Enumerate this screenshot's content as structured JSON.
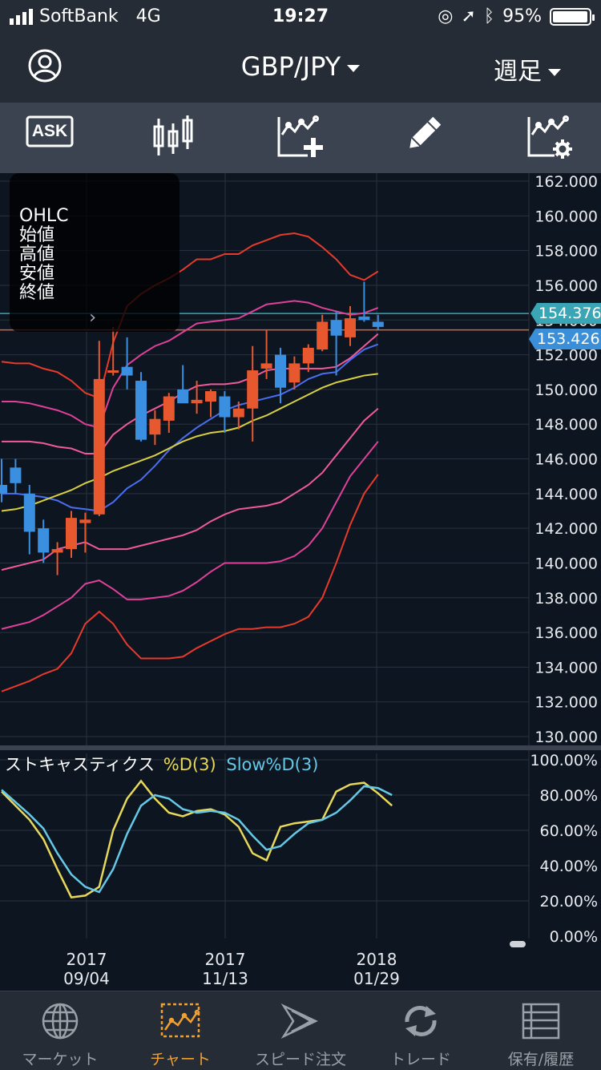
{
  "status_bar": {
    "carrier": "SoftBank",
    "network": "4G",
    "time": "19:27",
    "battery": "95%"
  },
  "header": {
    "pair": "GBP/JPY",
    "period": "週足"
  },
  "toolbar": {
    "ask_label": "ASK",
    "icons": [
      "ask-toggle-icon",
      "candlestick-icon",
      "add-indicator-icon",
      "draw-pencil-icon",
      "indicator-settings-icon"
    ]
  },
  "ohlc_panel": {
    "title": "OHLC",
    "open": "始値",
    "high": "高値",
    "low": "安値",
    "close": "終値"
  },
  "price_tags": {
    "bid": "154.376",
    "current": "153.426"
  },
  "chart_data": [
    {
      "type": "candlestick",
      "title": "GBP/JPY 週足",
      "y_ticks": [
        "162.000",
        "160.000",
        "158.000",
        "156.000",
        "154.000",
        "152.000",
        "150.000",
        "148.000",
        "146.000",
        "144.000",
        "142.000",
        "140.000",
        "138.000",
        "136.000",
        "134.000",
        "132.000",
        "130.000"
      ],
      "ylim": [
        130,
        162
      ],
      "x_ticks": [
        {
          "year": "2017",
          "date": "09/04"
        },
        {
          "year": "2017",
          "date": "11/13"
        },
        {
          "year": "2018",
          "date": "01/29"
        }
      ],
      "candles": [
        {
          "o": 144.5,
          "h": 146.0,
          "l": 143.5,
          "c": 144.0
        },
        {
          "o": 145.5,
          "h": 146.0,
          "l": 144.0,
          "c": 144.6
        },
        {
          "o": 144.0,
          "h": 144.5,
          "l": 140.5,
          "c": 141.8
        },
        {
          "o": 142.0,
          "h": 142.5,
          "l": 140.0,
          "c": 140.6
        },
        {
          "o": 140.6,
          "h": 141.2,
          "l": 139.3,
          "c": 140.8
        },
        {
          "o": 140.8,
          "h": 143.0,
          "l": 140.3,
          "c": 142.6
        },
        {
          "o": 142.3,
          "h": 142.9,
          "l": 140.6,
          "c": 142.5
        },
        {
          "o": 142.8,
          "h": 152.8,
          "l": 142.7,
          "c": 150.6
        },
        {
          "o": 151.0,
          "h": 153.6,
          "l": 150.8,
          "c": 151.1
        },
        {
          "o": 151.3,
          "h": 153.0,
          "l": 150.0,
          "c": 150.8
        },
        {
          "o": 150.5,
          "h": 151.0,
          "l": 147.0,
          "c": 147.1
        },
        {
          "o": 147.4,
          "h": 148.8,
          "l": 146.8,
          "c": 148.3
        },
        {
          "o": 148.2,
          "h": 149.8,
          "l": 147.5,
          "c": 149.6
        },
        {
          "o": 150.0,
          "h": 151.4,
          "l": 149.3,
          "c": 149.2
        },
        {
          "o": 149.2,
          "h": 150.5,
          "l": 148.6,
          "c": 149.4
        },
        {
          "o": 149.3,
          "h": 150.0,
          "l": 148.4,
          "c": 149.9
        },
        {
          "o": 149.6,
          "h": 149.9,
          "l": 147.5,
          "c": 148.4
        },
        {
          "o": 148.4,
          "h": 149.3,
          "l": 147.7,
          "c": 148.9
        },
        {
          "o": 148.9,
          "h": 152.5,
          "l": 147.0,
          "c": 151.1
        },
        {
          "o": 151.2,
          "h": 153.4,
          "l": 150.6,
          "c": 151.5
        },
        {
          "o": 152.0,
          "h": 152.4,
          "l": 149.2,
          "c": 150.1
        },
        {
          "o": 150.4,
          "h": 151.9,
          "l": 150.0,
          "c": 151.5
        },
        {
          "o": 151.5,
          "h": 152.6,
          "l": 151.0,
          "c": 152.4
        },
        {
          "o": 152.3,
          "h": 154.3,
          "l": 152.2,
          "c": 153.9
        },
        {
          "o": 154.0,
          "h": 154.5,
          "l": 150.8,
          "c": 153.1
        },
        {
          "o": 153.0,
          "h": 154.8,
          "l": 152.5,
          "c": 154.1
        },
        {
          "o": 154.2,
          "h": 156.2,
          "l": 153.9,
          "c": 154.0
        },
        {
          "o": 153.9,
          "h": 154.3,
          "l": 153.4,
          "c": 153.6
        }
      ],
      "bands": [
        {
          "color": "#e83a2a",
          "values": [
            151.6,
            151.5,
            151.5,
            151.2,
            151.0,
            150.5,
            149.8,
            149.5,
            152.7,
            154.8,
            155.5,
            156.0,
            156.4,
            156.9,
            157.5,
            157.5,
            157.8,
            157.8,
            158.3,
            158.6,
            158.9,
            159.0,
            158.8,
            158.2,
            157.5,
            156.6,
            156.3,
            156.8
          ]
        },
        {
          "color": "#e0409a",
          "values": [
            149.3,
            149.3,
            149.2,
            149.0,
            148.8,
            148.5,
            148.0,
            147.8,
            150.1,
            151.4,
            152.0,
            152.5,
            152.8,
            153.3,
            153.8,
            153.9,
            154.0,
            154.1,
            154.5,
            154.9,
            155.0,
            155.1,
            155.0,
            154.7,
            154.5,
            154.3,
            154.4,
            154.7
          ]
        },
        {
          "color": "#f05a9a",
          "values": [
            147.0,
            147.0,
            147.0,
            146.9,
            146.7,
            146.6,
            146.3,
            146.3,
            147.4,
            148.0,
            148.5,
            148.9,
            149.3,
            149.8,
            150.2,
            150.3,
            150.3,
            150.4,
            150.7,
            151.1,
            151.2,
            151.2,
            151.2,
            151.2,
            151.3,
            151.8,
            152.5,
            153.2
          ]
        },
        {
          "color": "#4a6ef0",
          "values": [
            144.0,
            144.0,
            143.9,
            143.8,
            143.6,
            143.2,
            143.1,
            143.0,
            143.5,
            144.3,
            144.8,
            145.6,
            146.5,
            147.2,
            147.8,
            148.3,
            148.8,
            149.1,
            149.3,
            149.5,
            149.7,
            150.1,
            150.6,
            150.9,
            151.0,
            151.7,
            152.3,
            152.6
          ]
        },
        {
          "color": "#d8d040",
          "values": [
            143.0,
            143.1,
            143.3,
            143.6,
            143.9,
            144.2,
            144.6,
            144.9,
            145.3,
            145.6,
            145.9,
            146.2,
            146.6,
            147.0,
            147.3,
            147.5,
            147.6,
            147.8,
            148.2,
            148.5,
            148.9,
            149.3,
            149.7,
            150.1,
            150.4,
            150.6,
            150.8,
            150.9
          ]
        },
        {
          "color": "#f05a9a",
          "values": [
            139.6,
            139.8,
            140.0,
            140.2,
            140.8,
            141.0,
            141.2,
            140.8,
            140.8,
            140.8,
            141.0,
            141.2,
            141.4,
            141.6,
            141.9,
            142.4,
            142.8,
            143.1,
            143.2,
            143.3,
            143.5,
            144.0,
            144.5,
            145.2,
            146.2,
            147.2,
            148.2,
            148.9
          ]
        },
        {
          "color": "#e0409a",
          "values": [
            136.2,
            136.4,
            136.6,
            137.0,
            137.5,
            138.0,
            138.8,
            139.0,
            138.5,
            137.9,
            137.9,
            138.0,
            138.1,
            138.4,
            138.9,
            139.5,
            140.0,
            140.0,
            140.0,
            140.0,
            140.1,
            140.4,
            141.0,
            142.0,
            143.5,
            145.0,
            146.0,
            147.0
          ]
        },
        {
          "color": "#e83a2a",
          "values": [
            132.6,
            132.9,
            133.2,
            133.6,
            133.9,
            134.8,
            136.5,
            137.2,
            136.5,
            135.3,
            134.5,
            134.5,
            134.5,
            134.6,
            135.1,
            135.5,
            135.9,
            136.2,
            136.2,
            136.3,
            136.3,
            136.5,
            136.9,
            138.0,
            140.0,
            142.2,
            144.0,
            145.1
          ]
        }
      ]
    },
    {
      "type": "line",
      "title": "ストキャスティクス",
      "series": [
        {
          "name": "%D(3)",
          "color": "#e8d85a",
          "values": [
            82,
            74,
            66,
            55,
            38,
            22,
            23,
            28,
            60,
            78,
            88,
            78,
            70,
            68,
            71,
            72,
            69,
            62,
            47,
            43,
            62,
            64,
            65,
            66,
            82,
            86,
            87,
            81,
            74
          ]
        },
        {
          "name": "Slow%D(3)",
          "color": "#64c8e6",
          "values": [
            83,
            76,
            69,
            61,
            47,
            35,
            28,
            25,
            38,
            58,
            74,
            80,
            78,
            72,
            70,
            71,
            70,
            66,
            57,
            49,
            51,
            58,
            64,
            66,
            70,
            77,
            85,
            84,
            80
          ]
        }
      ],
      "y_ticks": [
        "100.00%",
        "80.00%",
        "60.00%",
        "40.00%",
        "20.00%",
        "0.00%"
      ],
      "ylim": [
        0,
        100
      ]
    }
  ],
  "tabs": [
    {
      "label": "マーケット",
      "icon": "globe-icon"
    },
    {
      "label": "チャート",
      "icon": "chart-icon"
    },
    {
      "label": "スピード注文",
      "icon": "speed-order-icon"
    },
    {
      "label": "トレード",
      "icon": "trade-icon"
    },
    {
      "label": "保有/履歴",
      "icon": "history-icon"
    }
  ]
}
